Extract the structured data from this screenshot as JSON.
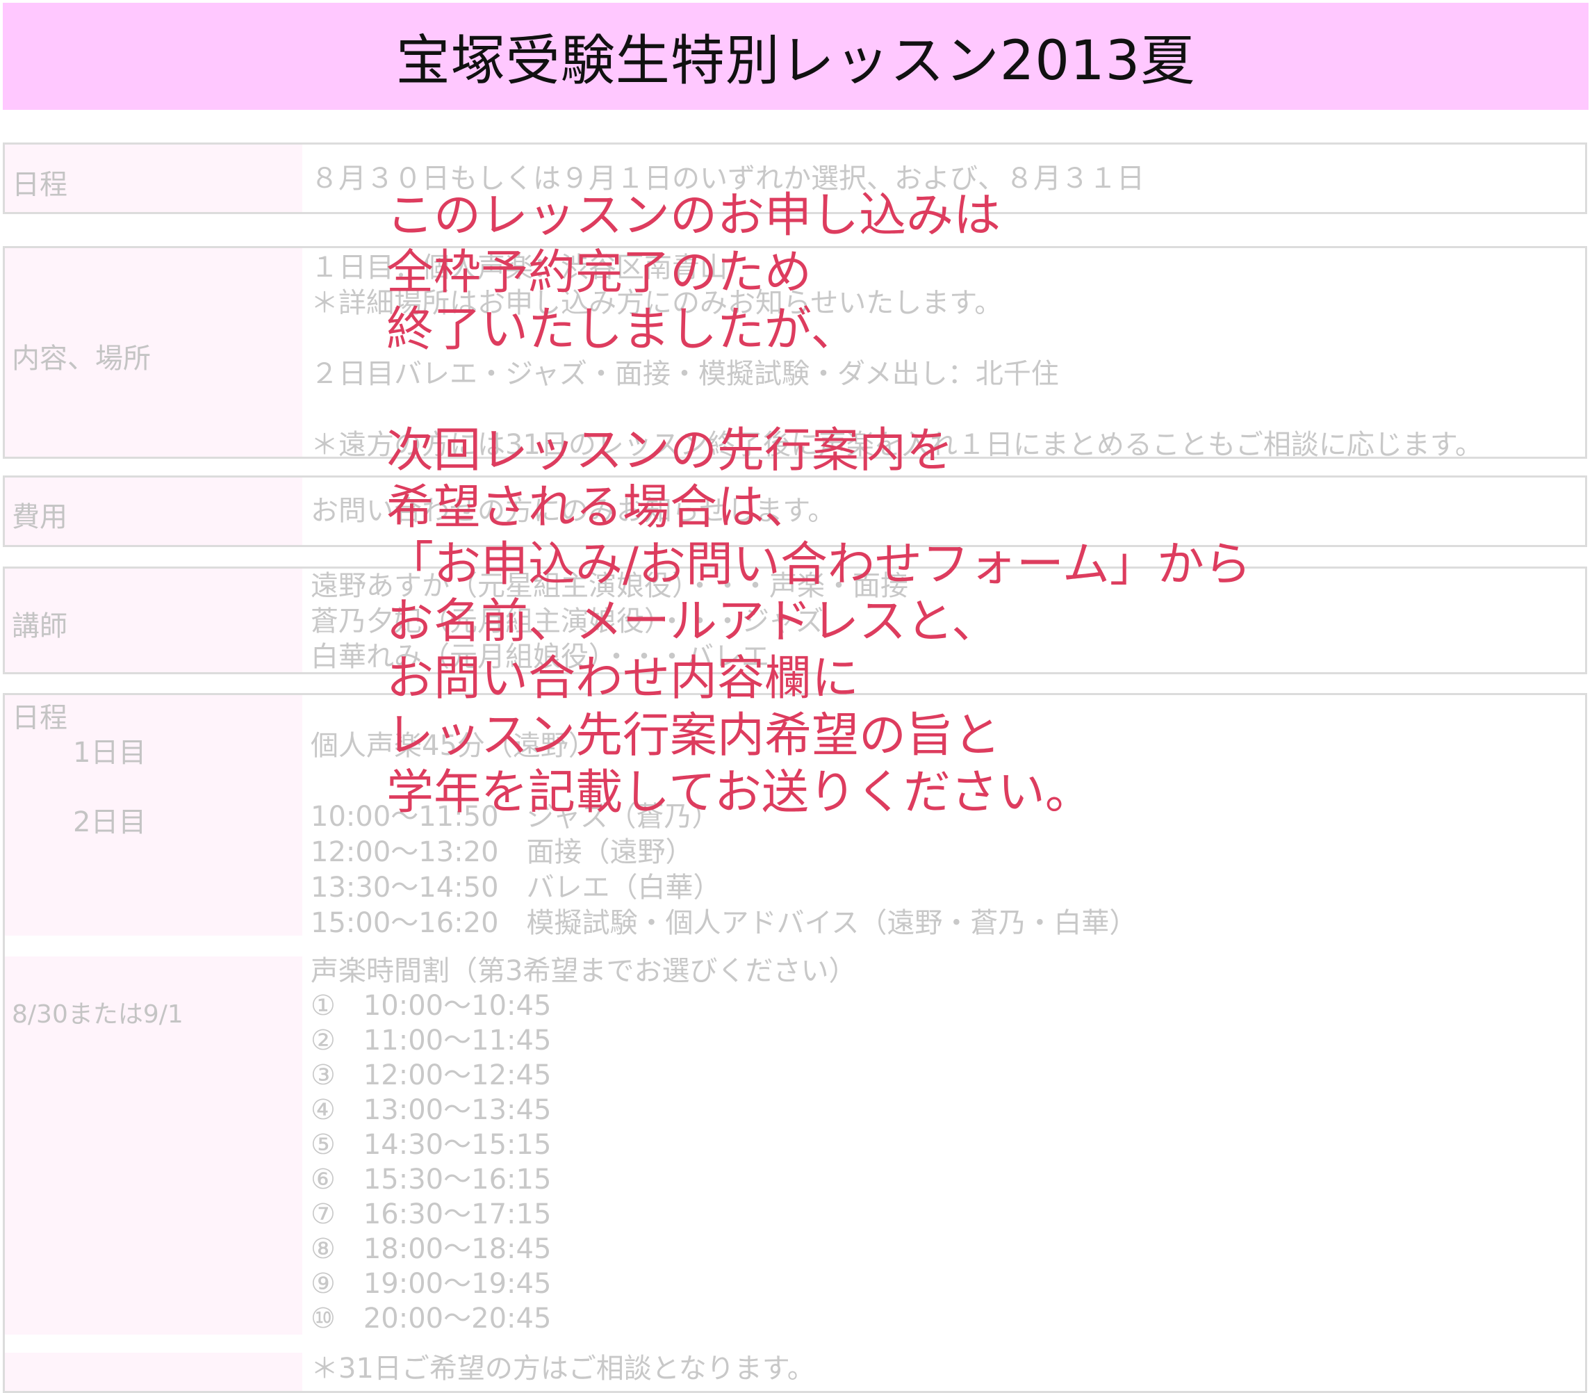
{
  "title": "宝塚受験生特別レッスン2013夏",
  "schedule_row": {
    "label": "日程",
    "value": "８月３０日もしくは９月１日のいずれか選択、および、８月３１日"
  },
  "content_row": {
    "label": "内容、場所",
    "lines": [
      "１日目：個人声楽：渋谷区南青山",
      "＊詳細場所はお申し込み方にのみお知らせいたします。",
      "",
      "２日目バレエ・ジャズ・面接・模擬試験・ダメ出し：北千住",
      "",
      "＊遠方の方には31日のレッスン終了後に声楽を入れ１日にまとめることもご相談に応じます。"
    ]
  },
  "fee_row": {
    "label": "費用",
    "value": "お問い合わせの方にのみお知らせします。"
  },
  "teacher_row": {
    "label": "講師",
    "lines": [
      "遠野あすか（元星組主演娘役）・・・声楽・面接",
      "蒼乃夕妃（元月組主演娘役）・・・ジャズ",
      "白華れみ（元月組娘役）・・・バレエ"
    ]
  },
  "timetable": {
    "label": "日程",
    "day1_label": "1日目",
    "day1_value": "個人声楽45分（遠野）",
    "day2_label": "2日目",
    "day2_lines": [
      "10:00～11:50　ジャズ（蒼乃）",
      "12:00～13:20　面接（遠野）",
      "13:30～14:50　バレエ（白華）",
      "15:00～16:20　模擬試験・個人アドバイス（遠野・蒼乃・白華）"
    ],
    "vocal_label": "8/30または9/1",
    "vocal_title": "声楽時間割（第3希望までお選びください）",
    "vocal_slots": [
      "①　10:00～10:45",
      "②　11:00～11:45",
      "③　12:00～12:45",
      "④　13:00～13:45",
      "⑤　14:30～15:15",
      "⑥　15:30～16:15",
      "⑦　16:30～17:15",
      "⑧　18:00～18:45",
      "⑨　19:00～19:45",
      "⑩　20:00～20:45"
    ],
    "note": "＊31日ご希望の方はご相談となります。"
  },
  "overlay": {
    "block1": [
      "このレッスンのお申し込みは",
      "全枠予約完了のため",
      "終了いたしましたが、"
    ],
    "block2": [
      "次回レッスンの先行案内を",
      "希望される場合は、",
      "「お申込み/お問い合わせフォーム」から",
      "お名前、メールアドレスと、",
      "お問い合わせ内容欄に",
      "レッスン先行案内希望の旨と",
      "学年を記載してお送りください。"
    ]
  },
  "colors": {
    "title_bg": "#ffc8ff",
    "overlay_text": "#dd3c5e",
    "faded_text": "#c8c8c8",
    "border": "#dcdcdc",
    "label_bg": "#fff4fb"
  }
}
